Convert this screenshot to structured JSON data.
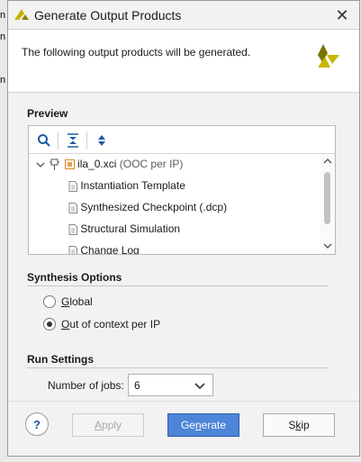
{
  "background": {
    "edge_letters": [
      "n",
      "n",
      "n"
    ]
  },
  "dialog": {
    "title": "Generate Output Products",
    "close_glyph": "✕",
    "header_message": "The following output products will be generated.",
    "brand_colors": {
      "logo_yellow": "#c8b400",
      "logo_dark": "#7a7300",
      "primary_button": "#4d85d8"
    }
  },
  "preview": {
    "section_label": "Preview",
    "toolbar": [
      {
        "icon": "search-icon"
      },
      {
        "icon": "collapse-all-icon"
      },
      {
        "icon": "expand-all-icon"
      }
    ],
    "tree": {
      "root": {
        "name": "ila_0.xci",
        "detail": "(OOC per IP)",
        "expanded": true
      },
      "children": [
        "Instantiation Template",
        "Synthesized Checkpoint (.dcp)",
        "Structural Simulation",
        "Change Log"
      ]
    }
  },
  "synthesis_options": {
    "section_label": "Synthesis Options",
    "options": [
      {
        "mnemonic": "G",
        "rest": "lobal",
        "checked": false
      },
      {
        "mnemonic": "O",
        "rest": "ut of context per IP",
        "checked": true
      }
    ]
  },
  "run_settings": {
    "section_label": "Run Settings",
    "jobs_label": "Number of jobs:",
    "jobs_value": "6"
  },
  "buttons": {
    "help": "?",
    "apply": {
      "mnemonic": "A",
      "rest": "pply"
    },
    "generate": {
      "pre": "Ge",
      "mnemonic": "n",
      "post": "erate"
    },
    "skip": {
      "pre": "S",
      "mnemonic": "k",
      "post": "ip"
    }
  }
}
